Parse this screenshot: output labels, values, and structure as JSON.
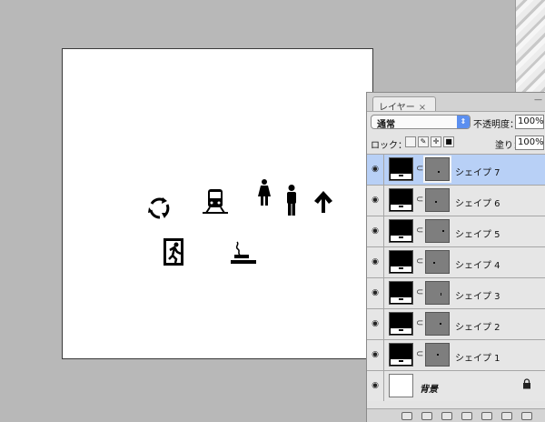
{
  "panel": {
    "tab_label": "レイヤー",
    "tab_close": "×",
    "menu_glyph": "—",
    "blend_mode": "通常",
    "opacity_label": "不透明度：",
    "opacity_value": "100%",
    "lock_label": "ロック：",
    "fill_label": "塗り：",
    "fill_value": "100%"
  },
  "layers": [
    {
      "name": "シェイプ 7",
      "selected": true
    },
    {
      "name": "シェイプ 6",
      "selected": false
    },
    {
      "name": "シェイプ 5",
      "selected": false
    },
    {
      "name": "シェイプ 4",
      "selected": false
    },
    {
      "name": "シェイプ 3",
      "selected": false
    },
    {
      "name": "シェイプ 2",
      "selected": false
    },
    {
      "name": "シェイプ 1",
      "selected": false
    }
  ],
  "background_layer": {
    "name": "背景"
  },
  "icons": {
    "canvas": [
      "recycle-icon",
      "train-icon",
      "woman-icon",
      "man-icon",
      "up-arrow-icon",
      "emergency-exit-icon",
      "smoking-area-icon"
    ],
    "lock_buttons": [
      "lock-transparent-icon",
      "lock-paint-icon",
      "lock-move-icon",
      "lock-all-icon"
    ],
    "footer": [
      "link-layers-icon",
      "fx-icon",
      "add-mask-icon",
      "adjustment-icon",
      "group-icon",
      "new-layer-icon",
      "trash-icon"
    ]
  },
  "colors": {
    "selected_row": "#b8d0f6",
    "canvas_bg": "#b8b8b8"
  }
}
